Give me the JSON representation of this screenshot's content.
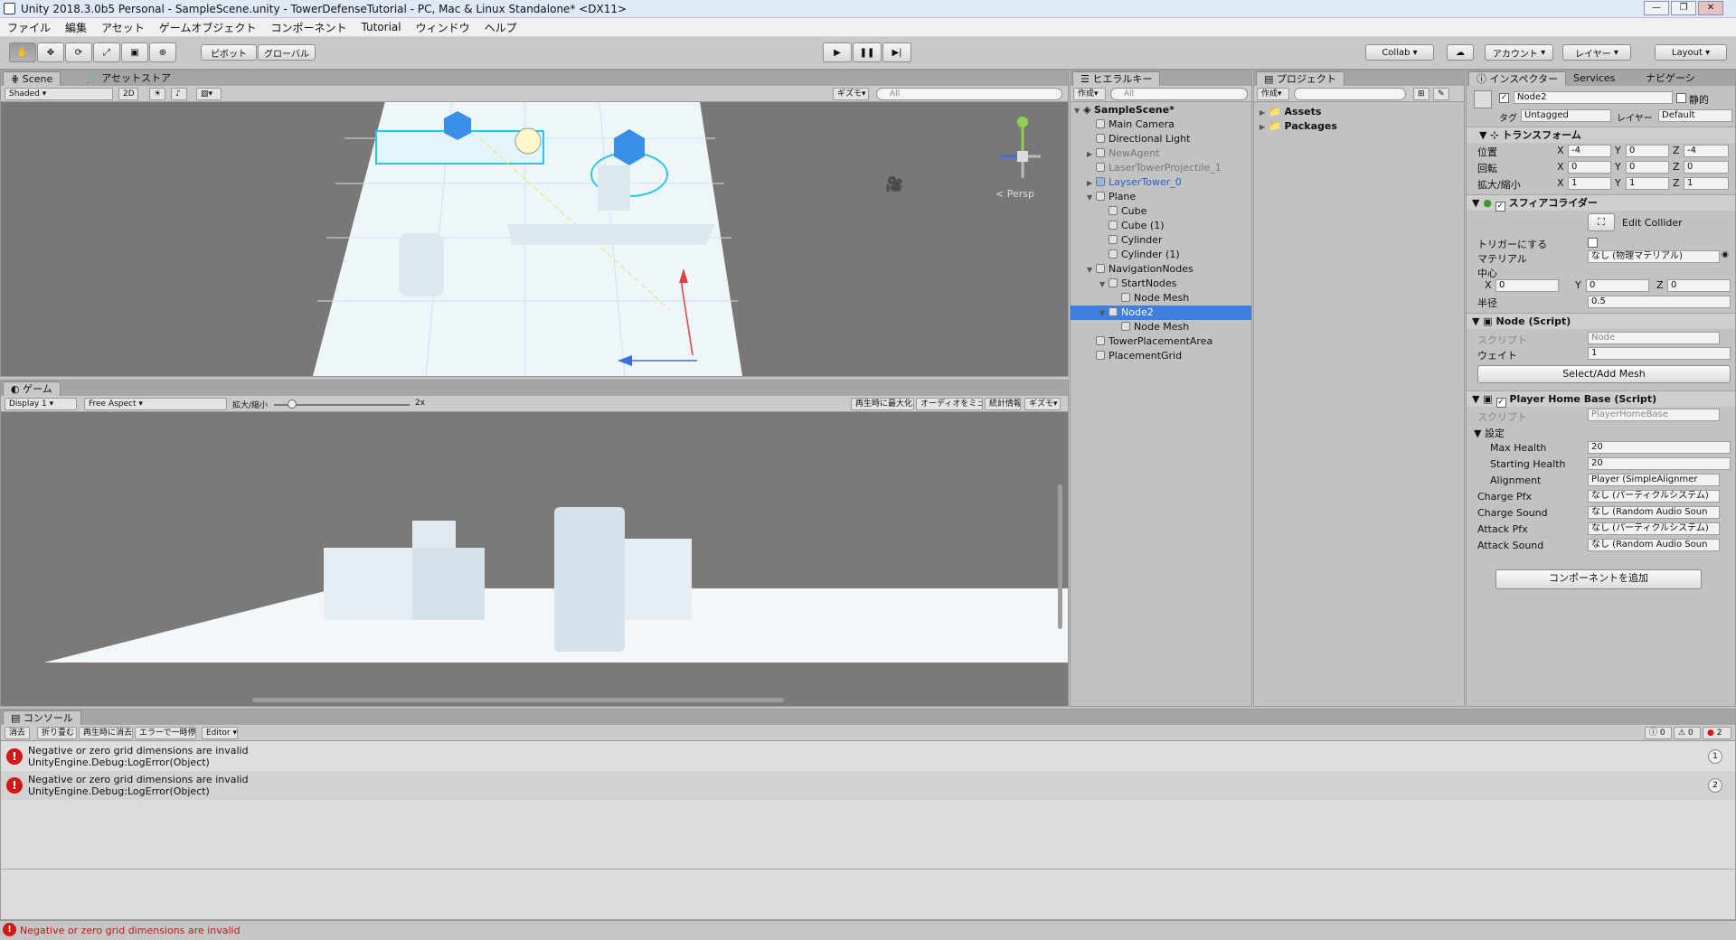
{
  "window": {
    "title": "Unity 2018.3.0b5 Personal - SampleScene.unity - TowerDefenseTutorial - PC, Mac & Linux Standalone* <DX11>",
    "controls": [
      "—",
      "❐",
      "✕"
    ]
  },
  "menu": [
    "ファイル",
    "編集",
    "アセット",
    "ゲームオブジェクト",
    "コンポーネント",
    "Tutorial",
    "ウィンドウ",
    "ヘルプ"
  ],
  "toolbar": {
    "pivot": "ピボット",
    "global": "グローバル",
    "collab": "Collab",
    "account": "アカウント",
    "layers": "レイヤー",
    "layout": "Layout"
  },
  "scene": {
    "tabs": [
      "Scene",
      "アセットストア"
    ],
    "shading": "Shaded",
    "mode2d": "2D",
    "gizmos": "ギズモ",
    "search": "All",
    "persp": "< Persp"
  },
  "game": {
    "tab": "ゲーム",
    "display": "Display 1",
    "aspect": "Free Aspect",
    "scale_label": "拡大/縮小",
    "scale_value": "2x",
    "scale_level": 0.1,
    "maximize": "再生時に最大化",
    "mute": "オーディオをミュート",
    "stats": "統計情報",
    "gizmos": "ギズモ"
  },
  "hierarchy": {
    "tab": "ヒエラルキー",
    "create": "作成",
    "search": "All",
    "items": [
      {
        "label": "SampleScene*",
        "level": 0,
        "arrow": "▼",
        "bold": true
      },
      {
        "label": "Main Camera",
        "level": 1,
        "arrow": ""
      },
      {
        "label": "Directional Light",
        "level": 1,
        "arrow": ""
      },
      {
        "label": "NewAgent",
        "level": 1,
        "arrow": "▶",
        "prefab": true
      },
      {
        "label": "LaserTowerProjectile_1",
        "level": 1,
        "arrow": "",
        "prefab": true
      },
      {
        "label": "LayserTower_0",
        "level": 1,
        "arrow": "▶",
        "blue": true
      },
      {
        "label": "Plane",
        "level": 1,
        "arrow": "▼"
      },
      {
        "label": "Cube",
        "level": 2,
        "arrow": ""
      },
      {
        "label": "Cube (1)",
        "level": 2,
        "arrow": ""
      },
      {
        "label": "Cylinder",
        "level": 2,
        "arrow": ""
      },
      {
        "label": "Cylinder (1)",
        "level": 2,
        "arrow": ""
      },
      {
        "label": "NavigationNodes",
        "level": 1,
        "arrow": "▼"
      },
      {
        "label": "StartNodes",
        "level": 2,
        "arrow": "▼"
      },
      {
        "label": "Node Mesh",
        "level": 3,
        "arrow": ""
      },
      {
        "label": "Node2",
        "level": 2,
        "arrow": "▼",
        "selected": true
      },
      {
        "label": "Node Mesh",
        "level": 3,
        "arrow": ""
      },
      {
        "label": "TowerPlacementArea",
        "level": 1,
        "arrow": ""
      },
      {
        "label": "PlacementGrid",
        "level": 1,
        "arrow": ""
      }
    ]
  },
  "project": {
    "tab": "プロジェクト",
    "create": "作成",
    "folders": [
      "Assets",
      "Packages"
    ]
  },
  "inspector": {
    "tabs": [
      "インスペクター",
      "Services",
      "ナビゲーシ"
    ],
    "object_name": "Node2",
    "static_label": "静的",
    "tag_label": "タグ",
    "tag_value": "Untagged",
    "layer_label": "レイヤー",
    "layer_value": "Default",
    "transform": {
      "title": "トランスフォーム",
      "position_label": "位置",
      "position": [
        "-4",
        "0",
        "-4"
      ],
      "rotation_label": "回転",
      "rotation": [
        "0",
        "0",
        "0"
      ],
      "scale_label": "拡大/縮小",
      "scale": [
        "1",
        "1",
        "1"
      ]
    },
    "sphere_collider": {
      "title": "スフィアコライダー",
      "edit_collider": "Edit Collider",
      "trigger_label": "トリガーにする",
      "material_label": "マテリアル",
      "material_value": "なし (物理マテリアル)",
      "center_label": "中心",
      "center": [
        "0",
        "0",
        "0"
      ],
      "radius_label": "半径",
      "radius": "0.5"
    },
    "node_script": {
      "title": "Node (Script)",
      "script_label": "スクリプト",
      "script_value": "Node",
      "weight_label": "ウェイト",
      "weight_value": "1",
      "button": "Select/Add Mesh"
    },
    "home_base": {
      "title": "Player Home Base (Script)",
      "script_label": "スクリプト",
      "script_value": "PlayerHomeBase",
      "settings_label": "設定",
      "max_health_label": "Max Health",
      "max_health": "20",
      "starting_health_label": "Starting Health",
      "starting_health": "20",
      "alignment_label": "Alignment",
      "alignment": "Player (SimpleAlignmer",
      "charge_pfx_label": "Charge Pfx",
      "charge_pfx": "なし (パーティクルシステム)",
      "charge_sound_label": "Charge Sound",
      "charge_sound": "なし (Random Audio Soun",
      "attack_pfx_label": "Attack Pfx",
      "attack_pfx": "なし (パーティクルシステム)",
      "attack_sound_label": "Attack Sound",
      "attack_sound": "なし (Random Audio Soun"
    },
    "add_component": "コンポーネントを追加"
  },
  "console": {
    "tab": "コンソール",
    "buttons": [
      "消去",
      "折り畳む",
      "再生時に消去",
      "エラーで一時停止",
      "Editor"
    ],
    "counts": {
      "info": "0",
      "warn": "0",
      "error": "2"
    },
    "entries": [
      {
        "line1": "Negative or zero grid dimensions are invalid",
        "line2": "UnityEngine.Debug:LogError(Object)",
        "count": "1"
      },
      {
        "line1": "Negative or zero grid dimensions are invalid",
        "line2": "UnityEngine.Debug:LogError(Object)",
        "count": "2"
      }
    ]
  },
  "statusbar": {
    "message": "Negative or zero grid dimensions are invalid"
  }
}
